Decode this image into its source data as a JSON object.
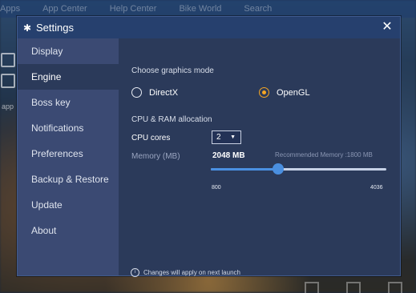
{
  "background": {
    "top_items": [
      "Apps",
      "App Center",
      "Help Center",
      "Bike World",
      "Search"
    ],
    "app_label": "app"
  },
  "dialog": {
    "title": "Settings",
    "close_icon": "close-icon"
  },
  "sidebar": {
    "items": [
      {
        "label": "Display",
        "active": false
      },
      {
        "label": "Engine",
        "active": true
      },
      {
        "label": "Boss key",
        "active": false
      },
      {
        "label": "Notifications",
        "active": false
      },
      {
        "label": "Preferences",
        "active": false
      },
      {
        "label": "Backup & Restore",
        "active": false
      },
      {
        "label": "Update",
        "active": false
      },
      {
        "label": "About",
        "active": false
      }
    ]
  },
  "engine": {
    "graphics_title": "Choose graphics mode",
    "directx_label": "DirectX",
    "opengl_label": "OpenGL",
    "selected_mode": "OpenGL",
    "cpu_ram_title": "CPU & RAM allocation",
    "cpu_label": "CPU cores",
    "cpu_value": "2",
    "memory_label": "Memory (MB)",
    "memory_value": "2048 MB",
    "recommended": "Recommended Memory :1800 MB",
    "memory_min": "800",
    "memory_max": "4036",
    "memory_current": 2048,
    "memory_min_num": 800,
    "memory_max_num": 4036,
    "note": "Changes will apply on next launch"
  },
  "colors": {
    "accent": "#f5a623",
    "slider": "#4a8fe0",
    "sidebar_bg": "#3b4a73",
    "panel_bg": "#2b3a5a"
  }
}
